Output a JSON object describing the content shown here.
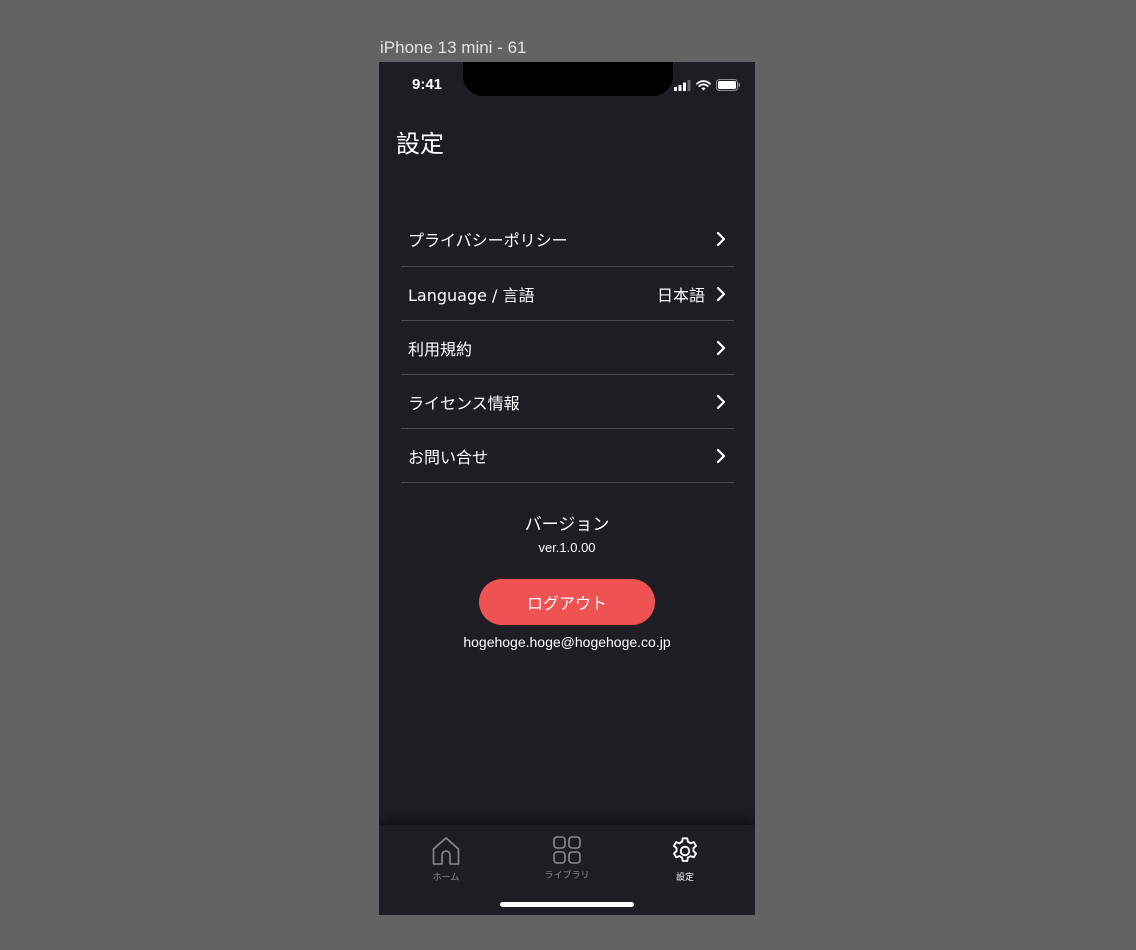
{
  "frame": {
    "label": "iPhone 13 mini - 61"
  },
  "status_bar": {
    "time": "9:41",
    "icons": [
      "signal-icon",
      "wifi-icon",
      "battery-icon"
    ]
  },
  "header": {
    "title": "設定"
  },
  "menu": {
    "items": [
      {
        "label": "プライバシーポリシー",
        "value": ""
      },
      {
        "label": "Language / 言語",
        "value": "日本語"
      },
      {
        "label": "利用規約",
        "value": ""
      },
      {
        "label": "ライセンス情報",
        "value": ""
      },
      {
        "label": "お問い合せ",
        "value": ""
      }
    ]
  },
  "version": {
    "title": "バージョン",
    "number": "ver.1.0.00"
  },
  "logout": {
    "label": "ログアウト",
    "color": "#ee5253"
  },
  "account": {
    "email": "hogehoge.hoge@hogehoge.co.jp"
  },
  "tab_bar": {
    "tabs": [
      {
        "label": "ホーム",
        "icon": "home-icon",
        "active": false
      },
      {
        "label": "ライブラリ",
        "icon": "grid-icon",
        "active": false
      },
      {
        "label": "設定",
        "icon": "gear-icon",
        "active": true
      }
    ],
    "active_color": "#ffffff",
    "inactive_color": "#8a8a8f"
  },
  "colors": {
    "background": "#1e1d24",
    "divider": "#4a4950",
    "canvas": "#636363"
  }
}
